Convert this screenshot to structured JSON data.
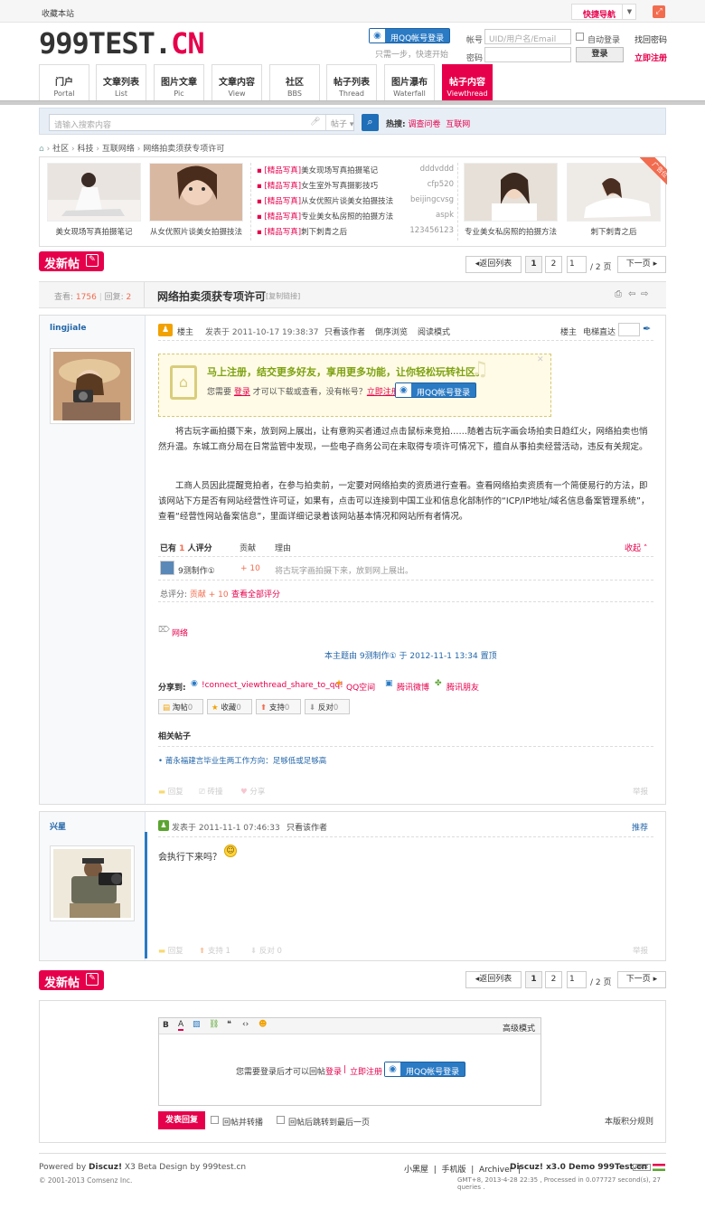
{
  "topbar": {
    "favorite": "收藏本站",
    "quicknav": "快捷导航"
  },
  "header": {
    "logo_main": "999TEST.",
    "logo_accent": "CN",
    "qq_login": "用QQ帐号登录",
    "one_step": "只需一步，快速开始",
    "account_label": "帐号",
    "account_placeholder": "UID/用户名/Email",
    "auto_login": "自动登录",
    "find_password": "找回密码",
    "password_label": "密码",
    "login_button": "登录",
    "register": "立即注册"
  },
  "nav": [
    {
      "cn": "门户",
      "en": "Portal"
    },
    {
      "cn": "文章列表",
      "en": "List"
    },
    {
      "cn": "图片文章",
      "en": "Pic"
    },
    {
      "cn": "文章内容",
      "en": "View"
    },
    {
      "cn": "社区",
      "en": "BBS"
    },
    {
      "cn": "帖子列表",
      "en": "Thread"
    },
    {
      "cn": "图片瀑布",
      "en": "Waterfall"
    },
    {
      "cn": "帖子内容",
      "en": "Viewthread"
    }
  ],
  "search": {
    "placeholder": "请输入搜索内容",
    "scope": "帖子",
    "hot_label": "热搜:",
    "hot1": "调查问卷",
    "hot2": "互联网"
  },
  "breadcrumb": [
    "社区",
    "科技",
    "互联网络",
    "网络拍卖须获专项许可"
  ],
  "banner": {
    "left_caps": [
      "美女现场写真拍摄笔记",
      "从女优照片谈美女拍摄技法"
    ],
    "right_caps": [
      "专业美女私房照的拍摄方法",
      "刺下刺青之后"
    ],
    "ribbon": "广告位",
    "list": [
      {
        "tag": "[精品写真]",
        "title": "美女现场写真拍摄笔记",
        "author": "dddvddd"
      },
      {
        "tag": "[精品写真]",
        "title": "女生室外写真摄影技巧",
        "author": "cfp520"
      },
      {
        "tag": "[精品写真]",
        "title": "从女优照片谈美女拍摄技法",
        "author": "beijingcvsg"
      },
      {
        "tag": "[精品写真]",
        "title": "专业美女私房照的拍摄方法",
        "author": "aspk"
      },
      {
        "tag": "[精品写真]",
        "title": "刺下刺青之后",
        "author": "123456123"
      }
    ]
  },
  "pager": {
    "post": "发新帖",
    "back": "返回列表",
    "p1": "1",
    "p2": "2",
    "current": "1",
    "total": "/ 2 页",
    "next": "下一页"
  },
  "thread": {
    "views_label": "查看:",
    "views": "1756",
    "replies_label": "回复:",
    "replies": "2",
    "title": "网络拍卖须获专项许可",
    "copy": "[复制链接]"
  },
  "post1": {
    "user": "lingjiale",
    "floor_label": "楼主",
    "posted": "发表于 2011-10-17 19:38:37",
    "only_author": "只看该作者",
    "reverse": "倒序浏览",
    "read_mode": "阅读模式",
    "floor_right": "楼主",
    "jump": "电梯直达",
    "promo_title": "马上注册，结交更多好友，享用更多功能，让你轻松玩转社区。",
    "promo_need": "您需要",
    "promo_login": "登录",
    "promo_mid": "才可以下载或查看，没有帐号？",
    "promo_reg": "立即注册",
    "para1": "将古玩字画拍摄下来，放到网上展出，让有意购买者通过点击鼠标来竞拍……随着古玩字画会场拍卖日趋红火，网络拍卖也悄然升温。东城工商分局在日常监管中发现，一些电子商务公司在未取得专项许可情况下，擅自从事拍卖经营活动，违反有关规定。",
    "para2": "工商人员因此提醒竞拍者，在参与拍卖前，一定要对网络拍卖的资质进行查看。查看网络拍卖资质有一个简便易行的方法，即该网站下方是否有网站经营性许可证，如果有，点击可以连接到中国工业和信息化部制作的“ICP/IP地址/域名信息备案管理系统”，查看“经营性网站备案信息”，里面详细记录着该网站基本情况和网站所有者情况。",
    "rate_has": "已有",
    "rate_count": "1",
    "rate_people": "人评分",
    "rate_col1": "贡献",
    "rate_col2": "理由",
    "rate_collapse": "收起",
    "rate_user": "9测制作①",
    "rate_val": "+ 10",
    "rate_reason": "将古玩字画拍摄下来，放到网上展出。",
    "rate_total_label": "总评分:",
    "rate_total": "贡献 + 10",
    "rate_all": "查看全部评分",
    "tag": "网络",
    "topped": "本主题由 9测制作① 于 2012-11-1 13:34 置顶",
    "share_label": "分享到:",
    "share1": "!connect_viewthread_share_to_qq!",
    "share2": "QQ空间",
    "share3": "腾讯微博",
    "share4": "腾讯朋友",
    "btn1": "淘帖",
    "btn1n": "0",
    "btn2": "收藏",
    "btn2n": "0",
    "btn3": "支持",
    "btn3n": "0",
    "btn4": "反对",
    "btn4n": "0",
    "related_title": "相关帖子",
    "related1": "莆永福建言毕业生两工作方向：足够低或足够高",
    "reply": "回复",
    "grab": "砖撞",
    "share": "分享",
    "report": "举报"
  },
  "post2": {
    "user": "兴星",
    "posted": "发表于 2011-11-1 07:46:33",
    "only_author": "只看该作者",
    "recommend": "推荐",
    "content": "会执行下来吗？",
    "reply": "回复",
    "support": "支持 1",
    "oppose": "反对 0",
    "report": "举报"
  },
  "editor": {
    "advanced": "高级模式",
    "need_login": "您需要登录后才可以回帖",
    "login": "登录",
    "sep": "|",
    "register": "立即注册",
    "submit": "发表回复",
    "opt1": "回帖并转播",
    "opt2": "回帖后跳转到最后一页",
    "rules": "本版积分规则"
  },
  "footer": {
    "powered": "Powered by",
    "discuz": "Discuz!",
    "ver": "X3 Beta Design by",
    "site": "999test.cn",
    "copyright": "© 2001-2013 Comsenz Inc.",
    "links": "小黑屋  |  手机版  |  Archiver  |",
    "demo": "Discuz! x3.0 Demo 999Test.cn",
    "gmt": "GMT+8, 2013-4-28 22:35 , Processed in 0.077727 second(s), 27 queries ."
  },
  "colors": {
    "accent": "#e6004c",
    "link": "#2366a8",
    "qq": "#2a7ac4"
  }
}
